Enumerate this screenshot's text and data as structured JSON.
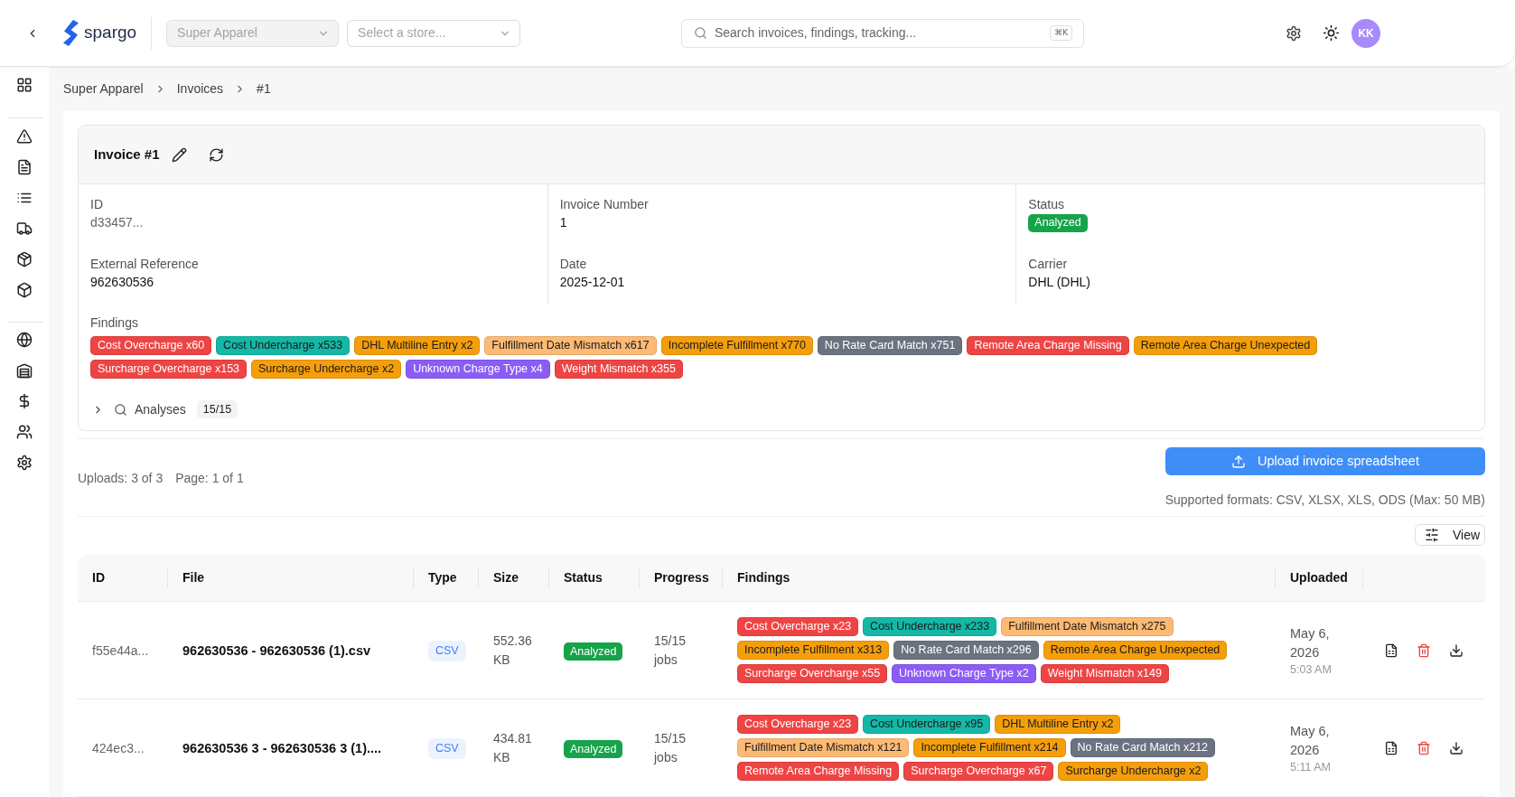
{
  "header": {
    "brand": "spargo",
    "company_select": {
      "value": "Super Apparel",
      "disabled": true
    },
    "store_select": {
      "placeholder": "Select a store..."
    },
    "search": {
      "placeholder": "Search invoices, findings, tracking...",
      "shortcut": "⌘K"
    },
    "avatar": "KK"
  },
  "breadcrumb": [
    "Super Apparel",
    "Invoices",
    "#1"
  ],
  "invoice": {
    "title": "Invoice #1",
    "fields": [
      {
        "label": "ID",
        "value": "d33457...",
        "kind": "muted"
      },
      {
        "label": "Invoice Number",
        "value": "1",
        "kind": "text"
      },
      {
        "label": "Status",
        "value": "Analyzed",
        "kind": "status"
      },
      {
        "label": "External Reference",
        "value": "962630536",
        "kind": "text"
      },
      {
        "label": "Date",
        "value": "2025-12-01",
        "kind": "text"
      },
      {
        "label": "Carrier",
        "value": "DHL (DHL)",
        "kind": "text"
      }
    ],
    "findings": {
      "label": "Findings",
      "tags": [
        {
          "text": "Cost Overcharge x60",
          "color": "#ef4444"
        },
        {
          "text": "Cost Undercharge x533",
          "color": "#14b8a6"
        },
        {
          "text": "DHL Multiline Entry x2",
          "color": "#f59e0b"
        },
        {
          "text": "Fulfillment Date Mismatch x617",
          "color": "#fdba74"
        },
        {
          "text": "Incomplete Fulfillment x770",
          "color": "#f59e0b"
        },
        {
          "text": "No Rate Card Match x751",
          "color": "#6b7280"
        },
        {
          "text": "Remote Area Charge Missing",
          "color": "#ef4444"
        },
        {
          "text": "Remote Area Charge Unexpected",
          "color": "#f59e0b"
        },
        {
          "text": "Surcharge Overcharge x153",
          "color": "#ef4444"
        },
        {
          "text": "Surcharge Undercharge x2",
          "color": "#f59e0b"
        },
        {
          "text": "Unknown Charge Type x4",
          "color": "#8b5cf6"
        },
        {
          "text": "Weight Mismatch x355",
          "color": "#ef4444"
        }
      ]
    },
    "analyses": {
      "label": "Analyses",
      "count": "15/15",
      "expanded": false
    }
  },
  "uploads": {
    "count": "Uploads: 3 of 3",
    "page": "Page: 1 of 1",
    "upload_button": "Upload invoice spreadsheet",
    "formats_note": "Supported formats: CSV, XLSX, XLS, ODS (Max: 50 MB)",
    "view_button": "View"
  },
  "table": {
    "columns": [
      "ID",
      "File",
      "Type",
      "Size",
      "Status",
      "Progress",
      "Findings",
      "Uploaded"
    ],
    "rows": [
      {
        "id": "f55e44a...",
        "file": "962630536 - 962630536 (1).csv",
        "type": "CSV",
        "size": "552.36 KB",
        "status": "Analyzed",
        "progress": "15/15 jobs",
        "findings": [
          {
            "text": "Cost Overcharge x23",
            "color": "#ef4444"
          },
          {
            "text": "Cost Undercharge x233",
            "color": "#14b8a6"
          },
          {
            "text": "Fulfillment Date Mismatch x275",
            "color": "#fdba74"
          },
          {
            "text": "Incomplete Fulfillment x313",
            "color": "#f59e0b"
          },
          {
            "text": "No Rate Card Match x296",
            "color": "#6b7280"
          },
          {
            "text": "Remote Area Charge Unexpected",
            "color": "#f59e0b"
          },
          {
            "text": "Surcharge Overcharge x55",
            "color": "#ef4444"
          },
          {
            "text": "Unknown Charge Type x2",
            "color": "#8b5cf6"
          },
          {
            "text": "Weight Mismatch x149",
            "color": "#ef4444"
          }
        ],
        "date": "May 6, 2026",
        "time": "5:03 AM"
      },
      {
        "id": "424ec3...",
        "file": "962630536 3 - 962630536 3 (1)....",
        "type": "CSV",
        "size": "434.81 KB",
        "status": "Analyzed",
        "progress": "15/15 jobs",
        "findings": [
          {
            "text": "Cost Overcharge x23",
            "color": "#ef4444"
          },
          {
            "text": "Cost Undercharge x95",
            "color": "#14b8a6"
          },
          {
            "text": "DHL Multiline Entry x2",
            "color": "#f59e0b"
          },
          {
            "text": "Fulfillment Date Mismatch x121",
            "color": "#fdba74"
          },
          {
            "text": "Incomplete Fulfillment x214",
            "color": "#f59e0b"
          },
          {
            "text": "No Rate Card Match x212",
            "color": "#6b7280"
          },
          {
            "text": "Remote Area Charge Missing",
            "color": "#ef4444"
          },
          {
            "text": "Surcharge Overcharge x67",
            "color": "#ef4444"
          },
          {
            "text": "Surcharge Undercharge x2",
            "color": "#f59e0b"
          }
        ],
        "date": "May 6, 2026",
        "time": "5:11 AM"
      }
    ]
  }
}
